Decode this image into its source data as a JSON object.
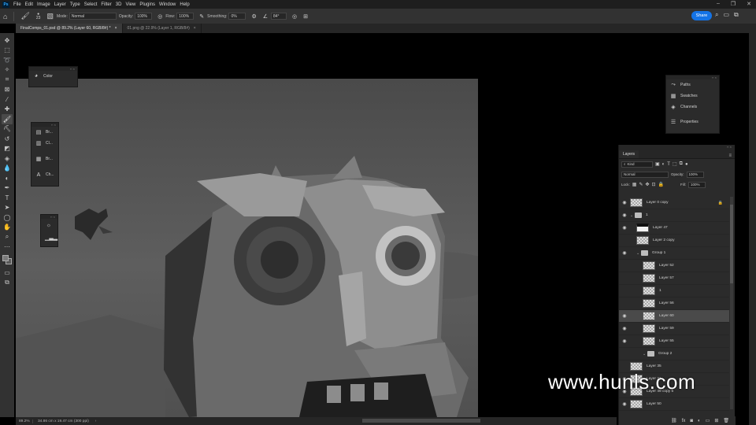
{
  "menubar": {
    "logo": "Ps",
    "items": [
      "File",
      "Edit",
      "Image",
      "Layer",
      "Type",
      "Select",
      "Filter",
      "3D",
      "View",
      "Plugins",
      "Window",
      "Help"
    ]
  },
  "options": {
    "brush_size": "23",
    "mode_label": "Mode:",
    "mode_value": "Normal",
    "opacity_label": "Opacity:",
    "opacity_value": "100%",
    "flow_label": "Flow:",
    "flow_value": "100%",
    "smoothing_label": "Smoothing:",
    "smoothing_value": "0%",
    "angle_value": "84°",
    "share_label": "Share"
  },
  "tabs": [
    {
      "label": "FinalComps_01.psd @ 89.2% (Layer 60, RGB/8#) *"
    },
    {
      "label": "01.png @ 22.9% (Layer 1, RGB/8#)"
    }
  ],
  "panels": {
    "color_label": "Color",
    "mini_tools": [
      "Br...",
      "Cl...",
      "Br...",
      "Ch..."
    ],
    "right_panel": [
      "Paths",
      "Swatches",
      "Channels",
      "Properties"
    ]
  },
  "layers_panel": {
    "tab": "Layers",
    "filter_kind": "Kind",
    "blend_mode": "Normal",
    "opacity_label": "Opacity:",
    "opacity_value": "100%",
    "lock_label": "Lock:",
    "fill_label": "Fill:",
    "fill_value": "100%",
    "layers": [
      {
        "name": "Layer 0 copy",
        "visible": true,
        "kind": "layer",
        "locked": true
      },
      {
        "name": "1",
        "visible": true,
        "kind": "group"
      },
      {
        "name": "Layer 47",
        "visible": true,
        "kind": "layer"
      },
      {
        "name": "Layer 2 copy",
        "visible": false,
        "kind": "layer"
      },
      {
        "name": "Group 1",
        "visible": true,
        "kind": "group"
      },
      {
        "name": "Layer 52",
        "visible": false,
        "kind": "layer"
      },
      {
        "name": "Layer 57",
        "visible": false,
        "kind": "layer"
      },
      {
        "name": "1",
        "visible": false,
        "kind": "layer"
      },
      {
        "name": "Layer 56",
        "visible": false,
        "kind": "layer"
      },
      {
        "name": "Layer 60",
        "visible": true,
        "kind": "layer",
        "selected": true
      },
      {
        "name": "Layer 59",
        "visible": true,
        "kind": "layer"
      },
      {
        "name": "Layer 55",
        "visible": true,
        "kind": "layer"
      },
      {
        "name": "Group 2",
        "visible": false,
        "kind": "group"
      },
      {
        "name": "Layer 35",
        "visible": false,
        "kind": "layer"
      },
      {
        "name": "Layer 21",
        "visible": true,
        "kind": "layer"
      },
      {
        "name": "Layer 49 copy 6",
        "visible": true,
        "kind": "layer"
      },
      {
        "name": "Layer 50",
        "visible": true,
        "kind": "layer"
      }
    ]
  },
  "status": {
    "zoom": "89.2%",
    "dimensions": "34.86 cm x 19.47 cm (300 ppi)"
  },
  "watermark": "www.hunls.com"
}
